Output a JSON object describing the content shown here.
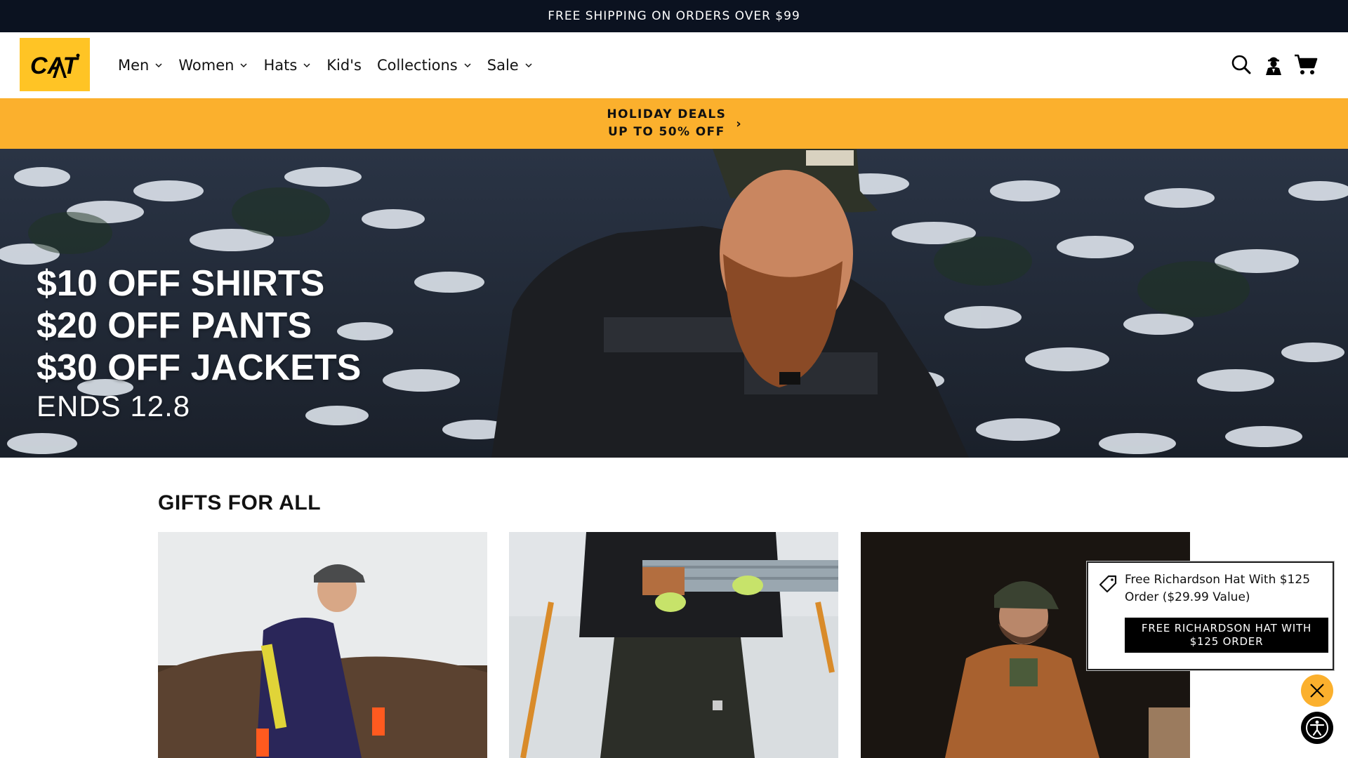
{
  "announcement": "FREE SHIPPING ON ORDERS OVER $99",
  "brand": {
    "logo_text": "CAT",
    "accent_color": "#ffc425",
    "promo_color": "#fbb02d"
  },
  "nav": {
    "items": [
      {
        "label": "Men",
        "has_dropdown": true
      },
      {
        "label": "Women",
        "has_dropdown": true
      },
      {
        "label": "Hats",
        "has_dropdown": true
      },
      {
        "label": "Kid's",
        "has_dropdown": false
      },
      {
        "label": "Collections",
        "has_dropdown": true
      },
      {
        "label": "Sale",
        "has_dropdown": true
      }
    ],
    "icons": [
      "search-icon",
      "account-icon",
      "cart-icon"
    ]
  },
  "promo": {
    "line1": "HOLIDAY DEALS",
    "line2": "UP TO 50% OFF",
    "arrow": "›"
  },
  "hero": {
    "lines": [
      "$10 OFF SHIRTS",
      "$20 OFF PANTS",
      "$30 OFF JACKETS"
    ],
    "sub": "ENDS 12.8"
  },
  "gifts": {
    "title": "GIFTS FOR ALL"
  },
  "popup": {
    "text": "Free Richardson Hat With $125 Order ($29.99 Value)",
    "button": "FREE RICHARDSON HAT WITH $125 ORDER"
  }
}
